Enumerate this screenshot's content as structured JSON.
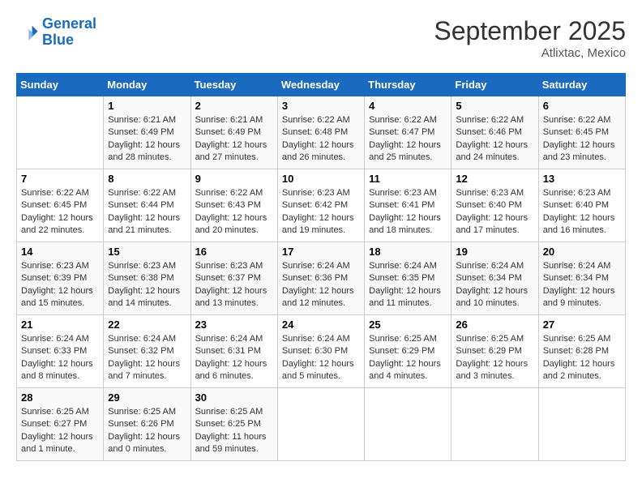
{
  "header": {
    "logo_line1": "General",
    "logo_line2": "Blue",
    "month_title": "September 2025",
    "location": "Atlixtac, Mexico"
  },
  "days_of_week": [
    "Sunday",
    "Monday",
    "Tuesday",
    "Wednesday",
    "Thursday",
    "Friday",
    "Saturday"
  ],
  "weeks": [
    [
      {
        "day": "",
        "info": ""
      },
      {
        "day": "1",
        "info": "Sunrise: 6:21 AM\nSunset: 6:49 PM\nDaylight: 12 hours\nand 28 minutes."
      },
      {
        "day": "2",
        "info": "Sunrise: 6:21 AM\nSunset: 6:49 PM\nDaylight: 12 hours\nand 27 minutes."
      },
      {
        "day": "3",
        "info": "Sunrise: 6:22 AM\nSunset: 6:48 PM\nDaylight: 12 hours\nand 26 minutes."
      },
      {
        "day": "4",
        "info": "Sunrise: 6:22 AM\nSunset: 6:47 PM\nDaylight: 12 hours\nand 25 minutes."
      },
      {
        "day": "5",
        "info": "Sunrise: 6:22 AM\nSunset: 6:46 PM\nDaylight: 12 hours\nand 24 minutes."
      },
      {
        "day": "6",
        "info": "Sunrise: 6:22 AM\nSunset: 6:45 PM\nDaylight: 12 hours\nand 23 minutes."
      }
    ],
    [
      {
        "day": "7",
        "info": "Sunrise: 6:22 AM\nSunset: 6:45 PM\nDaylight: 12 hours\nand 22 minutes."
      },
      {
        "day": "8",
        "info": "Sunrise: 6:22 AM\nSunset: 6:44 PM\nDaylight: 12 hours\nand 21 minutes."
      },
      {
        "day": "9",
        "info": "Sunrise: 6:22 AM\nSunset: 6:43 PM\nDaylight: 12 hours\nand 20 minutes."
      },
      {
        "day": "10",
        "info": "Sunrise: 6:23 AM\nSunset: 6:42 PM\nDaylight: 12 hours\nand 19 minutes."
      },
      {
        "day": "11",
        "info": "Sunrise: 6:23 AM\nSunset: 6:41 PM\nDaylight: 12 hours\nand 18 minutes."
      },
      {
        "day": "12",
        "info": "Sunrise: 6:23 AM\nSunset: 6:40 PM\nDaylight: 12 hours\nand 17 minutes."
      },
      {
        "day": "13",
        "info": "Sunrise: 6:23 AM\nSunset: 6:40 PM\nDaylight: 12 hours\nand 16 minutes."
      }
    ],
    [
      {
        "day": "14",
        "info": "Sunrise: 6:23 AM\nSunset: 6:39 PM\nDaylight: 12 hours\nand 15 minutes."
      },
      {
        "day": "15",
        "info": "Sunrise: 6:23 AM\nSunset: 6:38 PM\nDaylight: 12 hours\nand 14 minutes."
      },
      {
        "day": "16",
        "info": "Sunrise: 6:23 AM\nSunset: 6:37 PM\nDaylight: 12 hours\nand 13 minutes."
      },
      {
        "day": "17",
        "info": "Sunrise: 6:24 AM\nSunset: 6:36 PM\nDaylight: 12 hours\nand 12 minutes."
      },
      {
        "day": "18",
        "info": "Sunrise: 6:24 AM\nSunset: 6:35 PM\nDaylight: 12 hours\nand 11 minutes."
      },
      {
        "day": "19",
        "info": "Sunrise: 6:24 AM\nSunset: 6:34 PM\nDaylight: 12 hours\nand 10 minutes."
      },
      {
        "day": "20",
        "info": "Sunrise: 6:24 AM\nSunset: 6:34 PM\nDaylight: 12 hours\nand 9 minutes."
      }
    ],
    [
      {
        "day": "21",
        "info": "Sunrise: 6:24 AM\nSunset: 6:33 PM\nDaylight: 12 hours\nand 8 minutes."
      },
      {
        "day": "22",
        "info": "Sunrise: 6:24 AM\nSunset: 6:32 PM\nDaylight: 12 hours\nand 7 minutes."
      },
      {
        "day": "23",
        "info": "Sunrise: 6:24 AM\nSunset: 6:31 PM\nDaylight: 12 hours\nand 6 minutes."
      },
      {
        "day": "24",
        "info": "Sunrise: 6:24 AM\nSunset: 6:30 PM\nDaylight: 12 hours\nand 5 minutes."
      },
      {
        "day": "25",
        "info": "Sunrise: 6:25 AM\nSunset: 6:29 PM\nDaylight: 12 hours\nand 4 minutes."
      },
      {
        "day": "26",
        "info": "Sunrise: 6:25 AM\nSunset: 6:29 PM\nDaylight: 12 hours\nand 3 minutes."
      },
      {
        "day": "27",
        "info": "Sunrise: 6:25 AM\nSunset: 6:28 PM\nDaylight: 12 hours\nand 2 minutes."
      }
    ],
    [
      {
        "day": "28",
        "info": "Sunrise: 6:25 AM\nSunset: 6:27 PM\nDaylight: 12 hours\nand 1 minute."
      },
      {
        "day": "29",
        "info": "Sunrise: 6:25 AM\nSunset: 6:26 PM\nDaylight: 12 hours\nand 0 minutes."
      },
      {
        "day": "30",
        "info": "Sunrise: 6:25 AM\nSunset: 6:25 PM\nDaylight: 11 hours\nand 59 minutes."
      },
      {
        "day": "",
        "info": ""
      },
      {
        "day": "",
        "info": ""
      },
      {
        "day": "",
        "info": ""
      },
      {
        "day": "",
        "info": ""
      }
    ]
  ]
}
